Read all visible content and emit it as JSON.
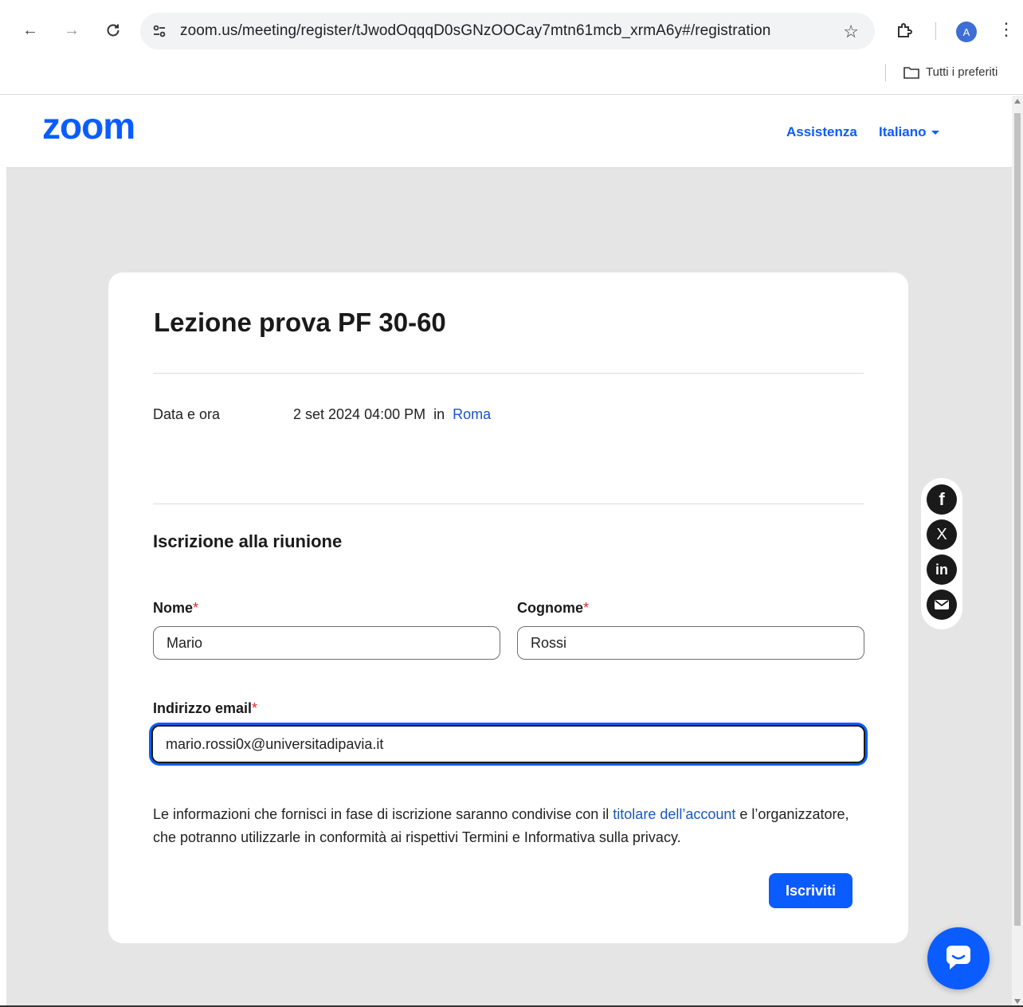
{
  "browser": {
    "url": "zoom.us/meeting/register/tJwodOqqqD0sGNzOOCay7mtn61mcb_xrmA6y#/registration",
    "avatar_letter": "A",
    "bookmarks_all": "Tutti i preferiti"
  },
  "header": {
    "logo": "zoom",
    "support": "Assistenza",
    "language": "Italiano"
  },
  "meeting": {
    "title": "Lezione prova PF 30-60",
    "datetime_label": "Data e ora",
    "datetime_value": "2 set 2024 04:00 PM  in  ",
    "timezone_city": "Roma"
  },
  "form": {
    "section_title": "Iscrizione alla riunione",
    "first_name_label": "Nome",
    "first_name_value": "Mario",
    "last_name_label": "Cognome",
    "last_name_value": "Rossi",
    "email_label": "Indirizzo email",
    "email_value": "mario.rossi0x@universitadipavia.it",
    "required_mark": "*",
    "notice_before": "Le informazioni che fornisci in fase di iscrizione saranno condivise con il ",
    "notice_link": "titolare dell’account",
    "notice_after": " e l’organizzatore, che potranno utilizzarle in conformità ai rispettivi Termini e Informativa sulla privacy.",
    "submit": "Iscriviti"
  },
  "share": {
    "facebook": "f",
    "x": "X",
    "linkedin": "in"
  },
  "colors": {
    "accent": "#0b5cff",
    "link": "#1a56c4",
    "required": "#e0292b",
    "page_bg": "#e5e5e5"
  }
}
